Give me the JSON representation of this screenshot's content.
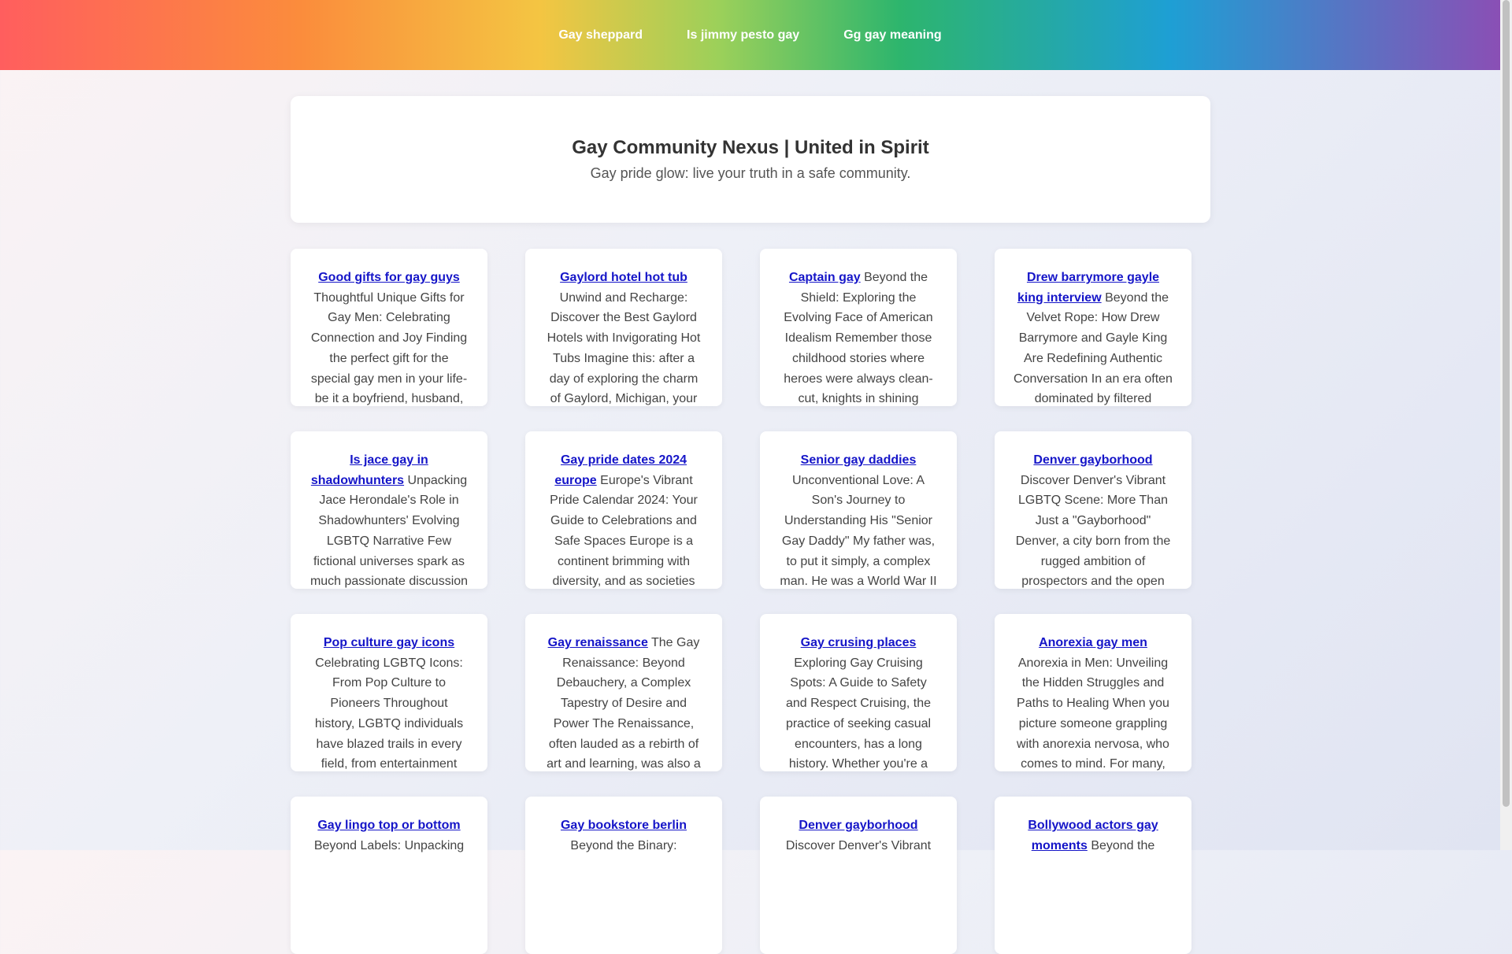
{
  "nav": {
    "links": [
      "Gay sheppard",
      "Is jimmy pesto gay",
      "Gg gay meaning"
    ]
  },
  "header": {
    "title": "Gay Community Nexus | United in Spirit",
    "subtitle": "Gay pride glow: live your truth in a safe community."
  },
  "cards": [
    {
      "title": "Good gifts for gay guys",
      "text": "Thoughtful Unique Gifts for Gay Men: Celebrating Connection and Joy Finding the perfect gift for the special gay men in your life- be it a boyfriend, husband,"
    },
    {
      "title": "Gaylord hotel hot tub",
      "text": "Unwind and Recharge: Discover the Best Gaylord Hotels with Invigorating Hot Tubs Imagine this: after a day of exploring the charm of Gaylord, Michigan, your"
    },
    {
      "title": "Captain gay",
      "text": "Beyond the Shield: Exploring the Evolving Face of American Idealism Remember those childhood stories where heroes were always clean-cut, knights in shining"
    },
    {
      "title": "Drew barrymore gayle king interview",
      "text": "Beyond the Velvet Rope: How Drew Barrymore and Gayle King Are Redefining Authentic Conversation In an era often dominated by filtered"
    },
    {
      "title": "Is jace gay in shadowhunters",
      "text": "Unpacking Jace Herondale's Role in Shadowhunters' Evolving LGBTQ Narrative Few fictional universes spark as much passionate discussion"
    },
    {
      "title": "Gay pride dates 2024 europe",
      "text": "Europe's Vibrant Pride Calendar 2024: Your Guide to Celebrations and Safe Spaces Europe is a continent brimming with diversity, and as societies"
    },
    {
      "title": "Senior gay daddies",
      "text": "Unconventional Love: A Son's Journey to Understanding His \"Senior Gay Daddy\" My father was, to put it simply, a complex man. He was a World War II"
    },
    {
      "title": "Denver gayborhood",
      "text": "Discover Denver's Vibrant LGBTQ Scene: More Than Just a \"Gayborhood\" Denver, a city born from the rugged ambition of prospectors and the open"
    },
    {
      "title": "Pop culture gay icons",
      "text": "Celebrating LGBTQ Icons: From Pop Culture to Pioneers Throughout history, LGBTQ individuals have blazed trails in every field, from entertainment"
    },
    {
      "title": "Gay renaissance",
      "text": "The Gay Renaissance: Beyond Debauchery, a Complex Tapestry of Desire and Power The Renaissance, often lauded as a rebirth of art and learning, was also a"
    },
    {
      "title": "Gay crusing places",
      "text": "Exploring Gay Cruising Spots: A Guide to Safety and Respect Cruising, the practice of seeking casual encounters, has a long history. Whether you're a"
    },
    {
      "title": "Anorexia gay men",
      "text": "Anorexia in Men: Unveiling the Hidden Struggles and Paths to Healing When you picture someone grappling with anorexia nervosa, who comes to mind. For many,"
    },
    {
      "title": "Gay lingo top or bottom",
      "text": "Beyond Labels: Unpacking"
    },
    {
      "title": "Gay bookstore berlin",
      "text": "Beyond the Binary:"
    },
    {
      "title": "Denver gayborhood",
      "text": "Discover Denver's Vibrant"
    },
    {
      "title": "Bollywood actors gay moments",
      "text": "Beyond the"
    }
  ]
}
